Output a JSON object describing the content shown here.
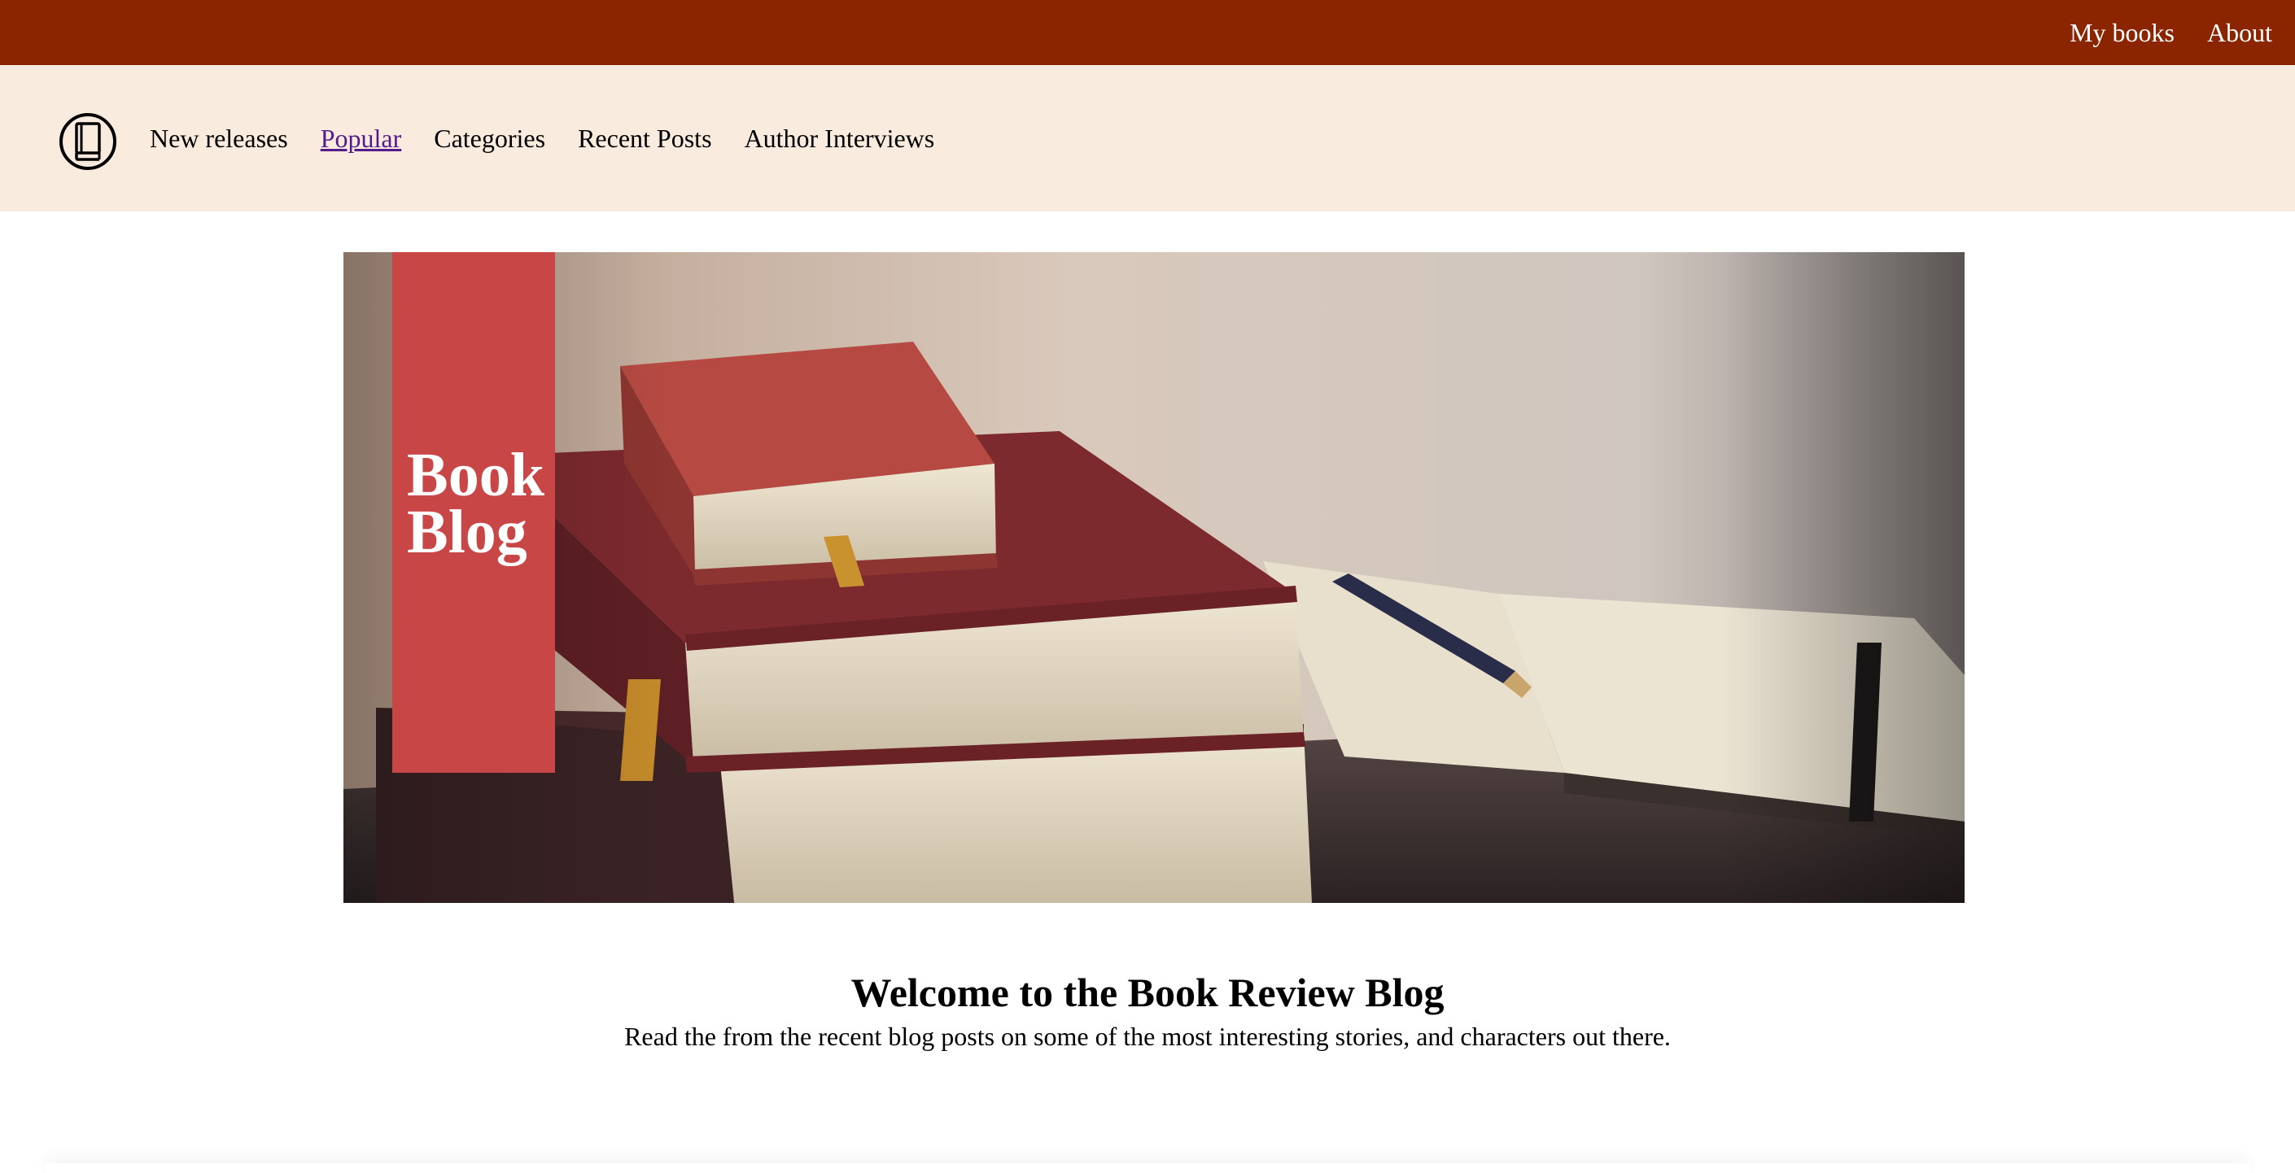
{
  "topbar": {
    "background": "#8b2500",
    "links": [
      {
        "label": "My books"
      },
      {
        "label": "About"
      }
    ]
  },
  "nav": {
    "background": "#f9ecdf",
    "logo_icon": "book-circle-icon",
    "items": [
      {
        "label": "New releases",
        "visited": false
      },
      {
        "label": "Popular",
        "visited": true
      },
      {
        "label": "Categories",
        "visited": false
      },
      {
        "label": "Recent Posts",
        "visited": false
      },
      {
        "label": "Author Interviews",
        "visited": false
      }
    ]
  },
  "hero": {
    "title_line1": "Book",
    "title_line2": "Blog",
    "badge_color": "#c94646"
  },
  "welcome": {
    "heading": "Welcome to the Book Review Blog",
    "text": "Read the from the recent blog posts on some of the most interesting stories, and characters out there."
  }
}
